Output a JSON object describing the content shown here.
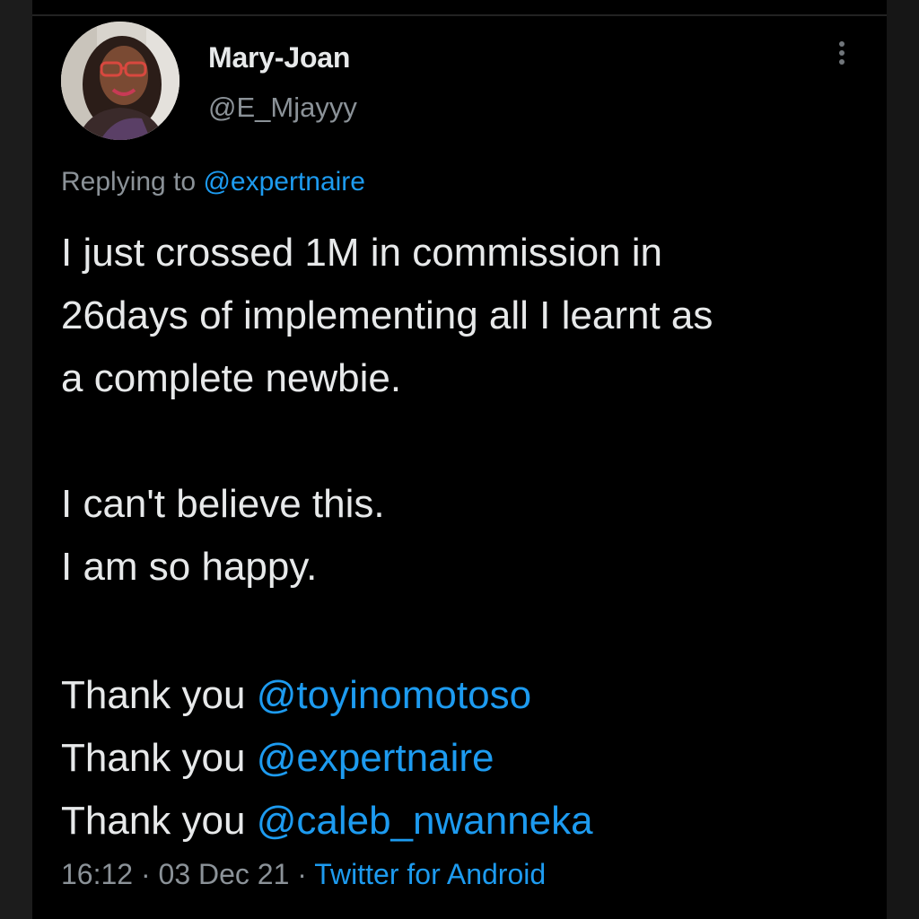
{
  "author": {
    "display_name": "Mary-Joan",
    "handle": "@E_Mjayyy"
  },
  "reply": {
    "prefix": "Replying to",
    "mention": "@expertnaire"
  },
  "tweet": {
    "lines": [
      "I just crossed 1M in commission in",
      "26days of implementing all I learnt as",
      "a complete newbie.",
      "I can't believe this.",
      "I am so happy."
    ],
    "thanks": [
      {
        "prefix": "Thank you",
        "mention": "@toyinomotoso"
      },
      {
        "prefix": "Thank you",
        "mention": "@expertnaire"
      },
      {
        "prefix": "Thank you",
        "mention": "@caleb_nwanneka"
      }
    ]
  },
  "meta": {
    "time": "16:12",
    "separator": "·",
    "date": "03 Dec 21",
    "source": "Twitter for Android"
  },
  "icons": {
    "more": "vertical-ellipsis-icon"
  },
  "colors": {
    "background": "#000000",
    "text": "#e7e9ea",
    "secondary_text": "#8b9298",
    "link": "#1d9bf0"
  }
}
